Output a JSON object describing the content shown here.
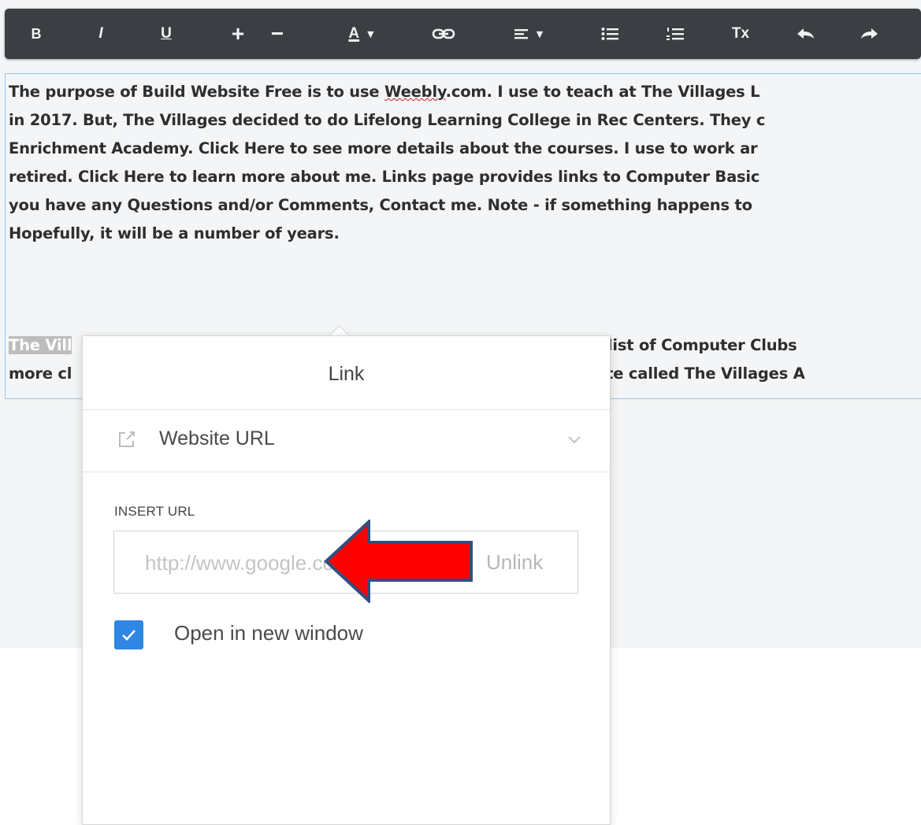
{
  "toolbar": {
    "bold": "B",
    "italic": "I",
    "underline": "U",
    "increase": "+",
    "decrease": "−",
    "font_color": "A",
    "clear_format": "Tx"
  },
  "content": {
    "lines": [
      "The purpose of Build Website Free is to use ",
      "in 2017.  But, The Villages decided to do Lifelong Learning College in Rec Centers.  They c",
      "Enrichment Academy.  Click Here to see more details about the courses.  I use to work ar",
      "retired.  Click Here to learn more about me.  Links page provides links to Computer Basic",
      "you have any Questions and/or Comments, Contact me. Note - if something happens to",
      " Hopefully, it will be a number of years."
    ],
    "weebly_word": "Weebly",
    "line1_after": ".com.  I use to teach at The Villages L",
    "line2_first": "The Vill",
    "line2_right": "te has a list of Computer Clubs",
    "line3_first": "more cl",
    "line3_right": "at website called The Villages A"
  },
  "link_popover": {
    "title": "Link",
    "link_type": "Website URL",
    "insert_label": "INSERT URL",
    "url_placeholder": "http://www.google.com",
    "unlink": "Unlink",
    "open_new_window": "Open in new window",
    "open_new_window_checked": true
  },
  "colors": {
    "toolbar_bg": "#3b3e42",
    "checkbox_accent": "#2f86e3",
    "arrow_fill": "#ff0000",
    "arrow_stroke": "#2f4f7f",
    "editor_border": "#9cc3e9"
  }
}
